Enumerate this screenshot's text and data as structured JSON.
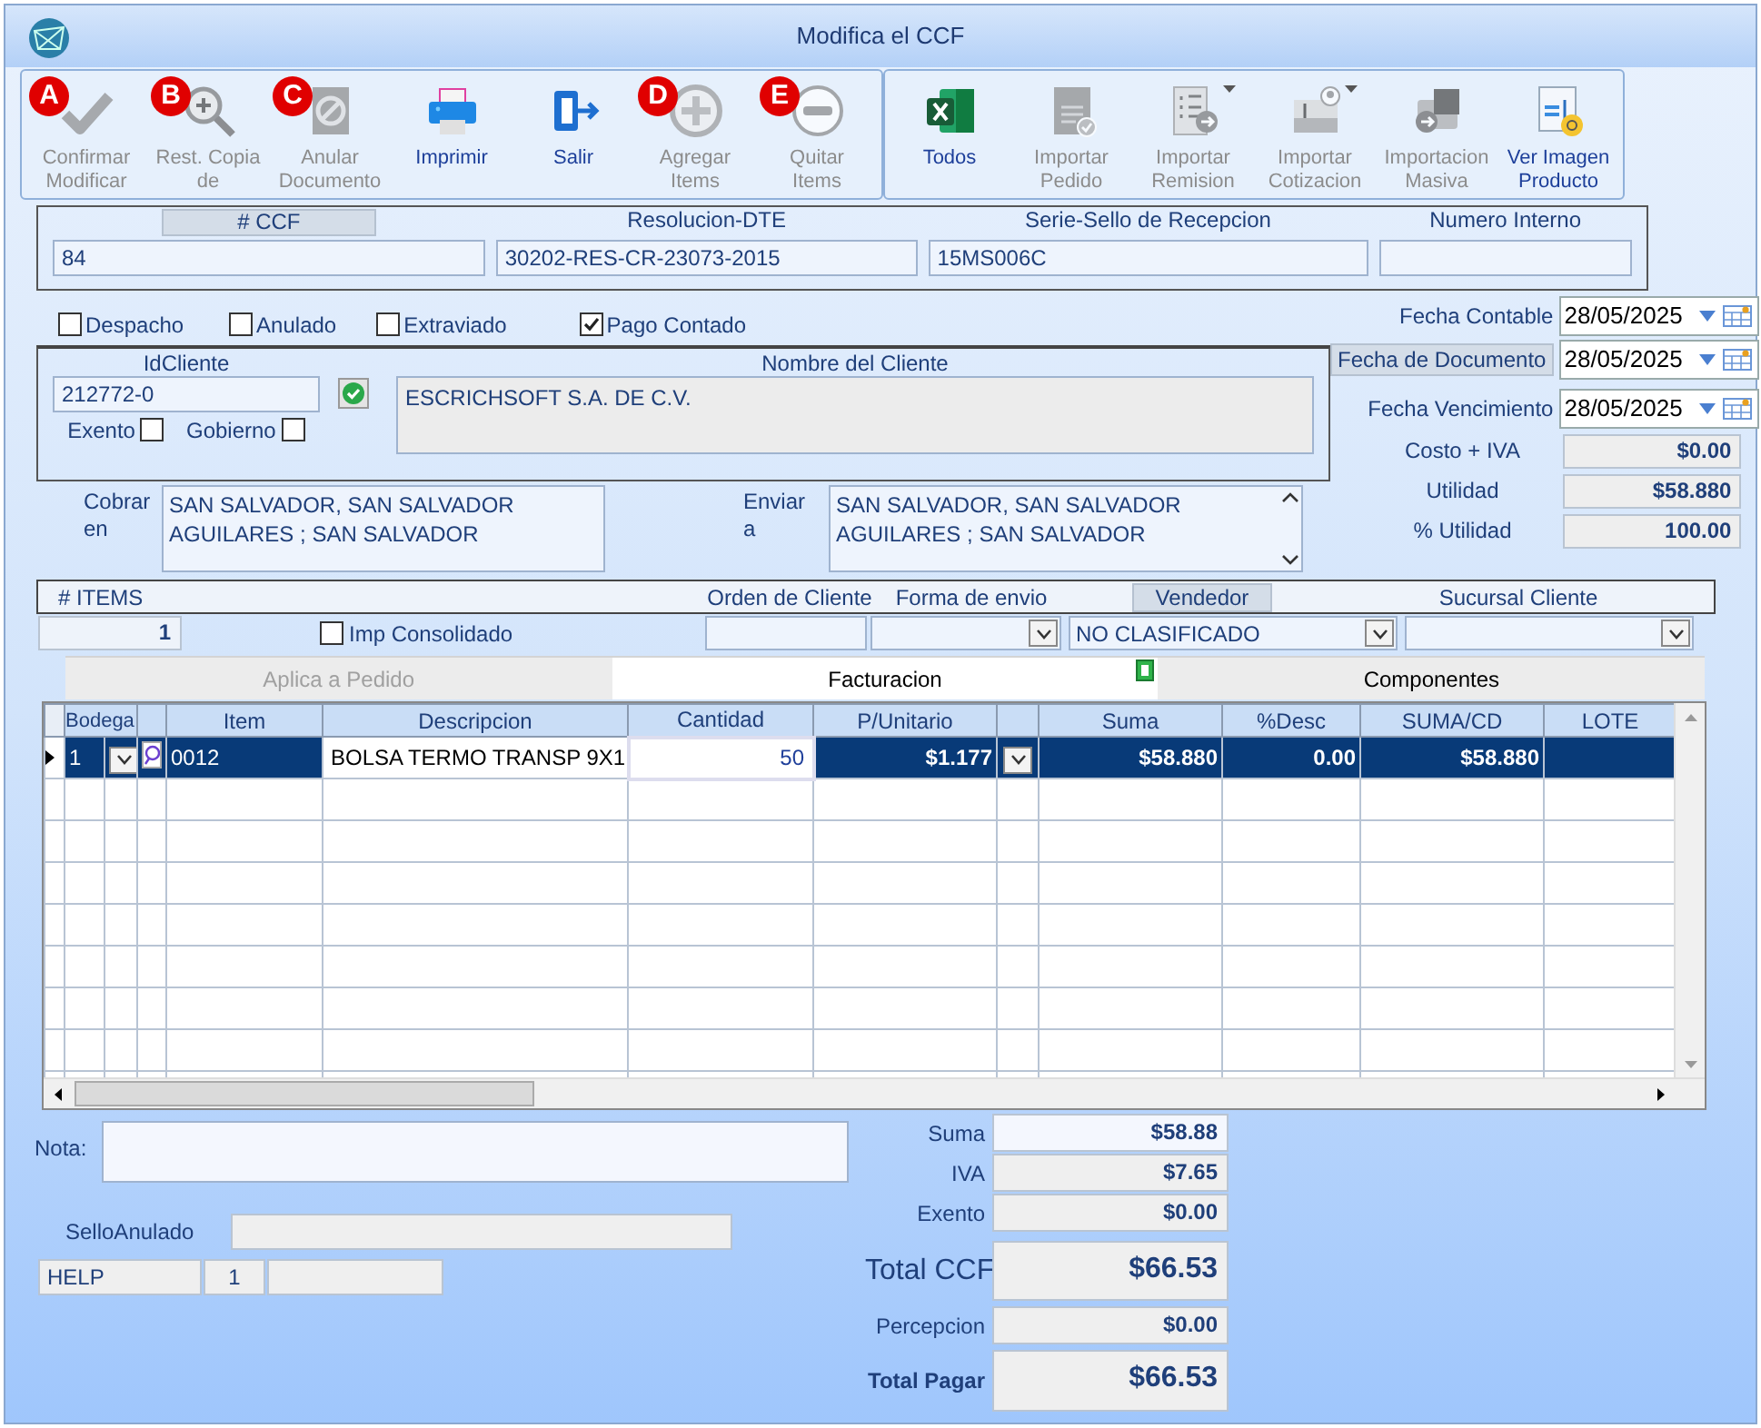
{
  "window": {
    "title": "Modifica el CCF"
  },
  "toolbar": [
    {
      "groups": [
        {
          "badge": "A",
          "lines": [
            "Confirmar",
            "Modificar"
          ],
          "disabled": true
        },
        {
          "badge": "B",
          "lines": [
            "Rest. Copia",
            "de"
          ],
          "disabled": true
        },
        {
          "badge": "C",
          "lines": [
            "Anular",
            "Documento"
          ],
          "disabled": true
        },
        {
          "lines": [
            "Imprimir"
          ],
          "disabled": false
        },
        {
          "lines": [
            "Salir"
          ],
          "disabled": false
        },
        {
          "badge": "D",
          "lines": [
            "Agregar",
            "Items"
          ],
          "disabled": true
        },
        {
          "badge": "E",
          "lines": [
            "Quitar",
            "Items"
          ],
          "disabled": true
        }
      ]
    },
    {
      "groups": [
        {
          "lines": [
            "Todos"
          ],
          "disabled": false
        },
        {
          "lines": [
            "Importar",
            "Pedido"
          ],
          "disabled": true
        },
        {
          "lines": [
            "Importar",
            "Remision"
          ],
          "disabled": true,
          "dropdown": true
        },
        {
          "lines": [
            "Importar",
            "Cotizacion"
          ],
          "disabled": true,
          "dropdown": true
        },
        {
          "lines": [
            "Importacion",
            "Masiva"
          ],
          "disabled": true
        },
        {
          "lines": [
            "Ver Imagen",
            "Producto"
          ],
          "disabled": false
        }
      ]
    }
  ],
  "header_fields": [
    {
      "label": "# CCF",
      "boxed": true,
      "value": "84"
    },
    {
      "label": "Resolucion-DTE",
      "boxed": false,
      "value": "30202-RES-CR-23073-2015"
    },
    {
      "label": "Serie-Sello de Recepcion",
      "boxed": false,
      "value": "15MS006C"
    },
    {
      "label": "Numero Interno",
      "boxed": false
    }
  ],
  "flags": [
    {
      "label": "Despacho",
      "checked": false
    },
    {
      "label": "Anulado",
      "checked": false
    },
    {
      "label": "Extraviado",
      "checked": false
    },
    {
      "label": "Pago Contado",
      "checked": true
    }
  ],
  "dates": [
    {
      "label": "Fecha Contable",
      "boxed": false,
      "value": "28/05/2025"
    },
    {
      "label": "Fecha de  Documento",
      "boxed": true,
      "value": "28/05/2025"
    },
    {
      "label": "Fecha Vencimiento",
      "boxed": false,
      "value": "28/05/2025"
    }
  ],
  "metrics": [
    {
      "label": "Costo + IVA",
      "value": "$0.00"
    },
    {
      "label": "Utilidad",
      "value": "$58.880"
    },
    {
      "label": "% Utilidad",
      "value": "100.00"
    }
  ],
  "client": {
    "id_label": "IdCliente",
    "id": "212772-0",
    "verified": true,
    "name_label": "Nombre del Cliente",
    "name": "ESCRICHSOFT S.A. DE C.V.",
    "options": [
      {
        "label": "Exento",
        "checked": false
      },
      {
        "label": "Gobierno",
        "checked": false
      }
    ]
  },
  "addresses": [
    {
      "label": [
        "Cobrar",
        "en"
      ],
      "lines": [
        "SAN SALVADOR, SAN SALVADOR",
        "AGUILARES ; SAN SALVADOR"
      ],
      "scrollbar": false
    },
    {
      "label": [
        "Enviar",
        "a"
      ],
      "lines": [
        "SAN SALVADOR, SAN SALVADOR",
        "AGUILARES ; SAN SALVADOR"
      ],
      "scrollbar": true
    }
  ],
  "items_bar": {
    "count_label": "# ITEMS",
    "count": "1",
    "consolidado": {
      "label": "Imp Consolidado",
      "checked": false
    },
    "order_label": "Orden de Cliente",
    "shipping_label": "Forma de envio",
    "seller_label": "Vendedor",
    "seller": "NO CLASIFICADO",
    "branch_label": "Sucursal Cliente"
  },
  "tabs": [
    {
      "label": "Aplica a Pedido",
      "selected": false,
      "disabled": true
    },
    {
      "label": "Facturacion",
      "selected": true,
      "disabled": false
    },
    {
      "label": "Componentes",
      "selected": false,
      "disabled": false
    }
  ],
  "grid": {
    "columns": [
      {
        "label": "Bodega",
        "kind": "bodega"
      },
      {
        "kind": "lookup"
      },
      {
        "label": "Item",
        "kind": "text"
      },
      {
        "label": "Descripcion",
        "kind": "desc"
      },
      {
        "label": "Cantidad",
        "kind": "edit"
      },
      {
        "label": "P/Unitario",
        "kind": "num"
      },
      {
        "kind": "combo"
      },
      {
        "label": "Suma",
        "kind": "num"
      },
      {
        "label": "%Desc",
        "kind": "num"
      },
      {
        "label": "SUMA/CD",
        "kind": "num"
      },
      {
        "label": "LOTE",
        "kind": "text"
      }
    ],
    "rows": [
      {
        "selected": true,
        "cells": [
          "1",
          "",
          "0012",
          "BOLSA TERMO TRANSP 9X1",
          "50",
          "$1.177",
          "",
          "$58.880",
          "0.00",
          "$58.880",
          ""
        ]
      }
    ]
  },
  "nota_label": "Nota:",
  "sello_label": "SelloAnulado",
  "status_bar": [
    "HELP",
    "1"
  ],
  "totals": [
    {
      "label": "Suma",
      "kind": "small",
      "value": "$58.88"
    },
    {
      "label": "IVA",
      "kind": "small",
      "value": "$7.65"
    },
    {
      "label": "Exento",
      "kind": "small",
      "value": "$0.00"
    },
    {
      "label": "Total CCF",
      "kind": "large",
      "value": "$66.53"
    },
    {
      "label": "Percepcion",
      "kind": "small",
      "value": "$0.00"
    },
    {
      "label": "Total Pagar",
      "kind": "strong",
      "value": "$66.53"
    }
  ]
}
